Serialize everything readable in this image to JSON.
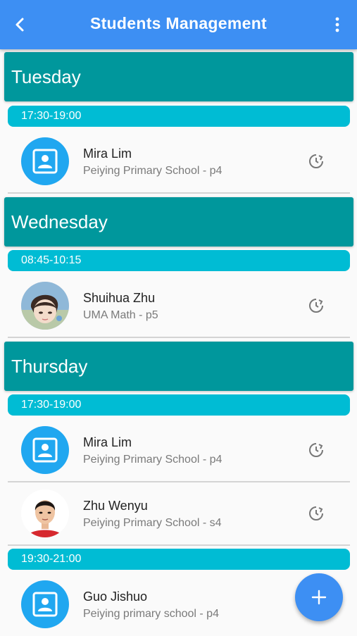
{
  "appbar": {
    "title": "Students Management",
    "back_icon": "arrow-back-icon",
    "menu_icon": "more-vertical-icon",
    "color": "#3d8ff3"
  },
  "days": [
    {
      "label": "Tuesday",
      "slots": [
        {
          "time": "17:30-19:00",
          "students": [
            {
              "name": "Mira Lim",
              "school": "Peiying Primary School - p4",
              "avatar": "contact-placeholder"
            }
          ]
        }
      ]
    },
    {
      "label": "Wednesday",
      "slots": [
        {
          "time": "08:45-10:15",
          "students": [
            {
              "name": "Shuihua Zhu",
              "school": "UMA Math - p5",
              "avatar": "photo"
            }
          ]
        }
      ]
    },
    {
      "label": "Thursday",
      "slots": [
        {
          "time": "17:30-19:00",
          "students": [
            {
              "name": "Mira Lim",
              "school": "Peiying Primary School - p4",
              "avatar": "contact-placeholder"
            },
            {
              "name": "Zhu Wenyu",
              "school": "Peiying Primary School - s4",
              "avatar": "photo"
            }
          ]
        },
        {
          "time": "19:30-21:00",
          "students": [
            {
              "name": "Guo Jishuo",
              "school": "Peiying primary school - p4",
              "avatar": "contact-placeholder"
            }
          ]
        }
      ]
    }
  ],
  "colors": {
    "day_header": "#00979c",
    "time_slot": "#00bcd4",
    "avatar_placeholder": "#20a7f0"
  },
  "fab": {
    "icon": "add-icon"
  }
}
